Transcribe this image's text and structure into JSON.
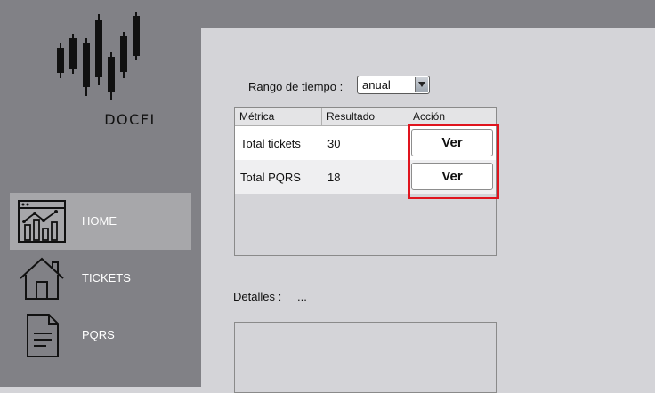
{
  "app": {
    "logo_text": "DOCFI"
  },
  "sidebar": {
    "items": [
      {
        "label": "HOME",
        "icon": "dashboard-icon",
        "active": true
      },
      {
        "label": "TICKETS",
        "icon": "house-icon",
        "active": false
      },
      {
        "label": "PQRS",
        "icon": "document-icon",
        "active": false
      }
    ]
  },
  "filter": {
    "label": "Rango de tiempo :",
    "selected": "anual"
  },
  "table": {
    "headers": [
      "Métrica",
      "Resultado",
      "Acción"
    ],
    "rows": [
      {
        "metric": "Total tickets",
        "result": "30",
        "action": "Ver"
      },
      {
        "metric": "Total PQRS",
        "result": "18",
        "action": "Ver"
      }
    ]
  },
  "details": {
    "label": "Detalles :",
    "value": "..."
  },
  "colors": {
    "sidebar": "#818186",
    "content": "#d4d4d8",
    "active_item": "#a7a7aa",
    "highlight": "#e0141e"
  }
}
